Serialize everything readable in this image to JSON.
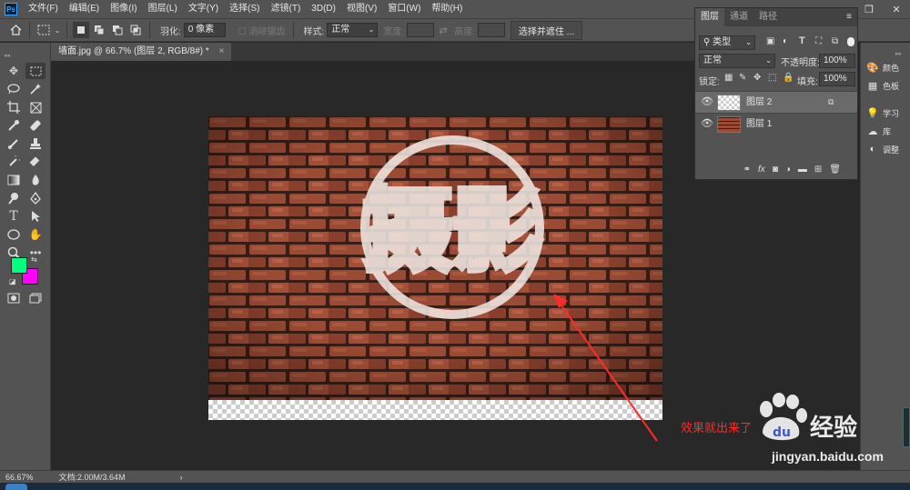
{
  "app": {
    "logo": "Ps"
  },
  "menu": {
    "items": [
      "文件(F)",
      "编辑(E)",
      "图像(I)",
      "图层(L)",
      "文字(Y)",
      "选择(S)",
      "滤镜(T)",
      "3D(D)",
      "视图(V)",
      "窗口(W)",
      "帮助(H)"
    ]
  },
  "window_controls": {
    "minimize": "—",
    "maximize": "❐",
    "close": "✕"
  },
  "options": {
    "feather_label": "羽化:",
    "feather_value": "0 像素",
    "antialias_label": "消除锯齿",
    "style_label": "样式:",
    "style_value": "正常",
    "width_label": "宽度:",
    "height_label": "高度:",
    "select_mask_label": "选择并遮住 ..."
  },
  "document": {
    "tab_title": "墙面.jpg @ 66.7% (图层 2, RGB/8#) *",
    "close": "×"
  },
  "status": {
    "zoom": "66.67%",
    "doc_info": "文档:2.00M/3.64M",
    "arrow": "›"
  },
  "colors": {
    "foreground": "#00ff7f",
    "background": "#ff00ff",
    "accent": "#31a8ff",
    "annotation": "#ff2a2a"
  },
  "layers_panel": {
    "tabs": [
      "图层",
      "通道",
      "路径"
    ],
    "filter_value": "类型",
    "blend_mode": "正常",
    "opacity_label": "不透明度:",
    "opacity_value": "100%",
    "lock_label": "锁定:",
    "fill_label": "填充:",
    "fill_value": "100%",
    "layers": [
      {
        "name": "图层 2",
        "visible": true,
        "selected": true
      },
      {
        "name": "图层 1",
        "visible": true,
        "selected": false
      }
    ],
    "footer_icons": [
      "link-icon",
      "fx-icon",
      "mask-icon",
      "adjustment-icon",
      "folder-icon",
      "new-layer-icon",
      "trash-icon"
    ]
  },
  "right_dock": {
    "items": [
      "颜色",
      "色板",
      "学习",
      "库",
      "调整"
    ]
  },
  "canvas": {
    "stamp_text": "摄影"
  },
  "annotation": {
    "text": "效果就出来了"
  },
  "watermark": {
    "brand": "经验",
    "url": "jingyan.baidu.com"
  }
}
